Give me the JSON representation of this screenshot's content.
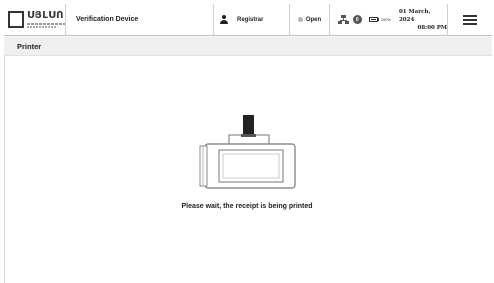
{
  "header": {
    "logo_text": "ՍՅԼՍՈ",
    "device_title": "Verification Device",
    "user_label": "Registrar",
    "status_label": "Open",
    "notification_count": "0",
    "battery_label": "100%",
    "date": "01 March, 2024",
    "time": "08:00 PM"
  },
  "section": {
    "title": "Printer"
  },
  "main": {
    "message": "Please wait, the receipt is being printed"
  },
  "icons": {
    "user": "user-icon",
    "status": "status-dot-icon",
    "network": "network-icon",
    "battery": "battery-icon",
    "menu": "hamburger-menu-icon",
    "printer": "printer-icon"
  },
  "colors": {
    "status_dot": "#b5b5b5",
    "section_bg": "#efefef",
    "ink": "#222222"
  }
}
